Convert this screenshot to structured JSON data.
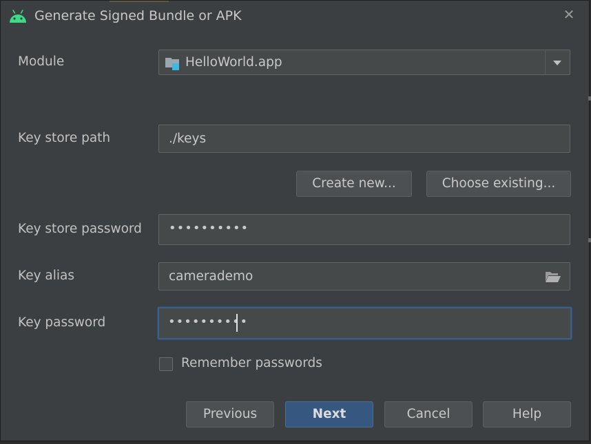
{
  "window": {
    "title": "Generate Signed Bundle or APK",
    "icon": "android-icon",
    "close_glyph": "✕"
  },
  "form": {
    "module": {
      "label": "Module",
      "value": "HelloWorld.app",
      "icon": "module-folder-icon"
    },
    "key_store_path": {
      "label": "Key store path",
      "value": "./keys"
    },
    "key_store_buttons": {
      "create_new": "Create new...",
      "choose_existing": "Choose existing..."
    },
    "key_store_password": {
      "label": "Key store password",
      "value": "••••••••••"
    },
    "key_alias": {
      "label": "Key alias",
      "value": "camerademo",
      "icon": "folder-open-icon"
    },
    "key_password": {
      "label": "Key password",
      "value": "••••••••••"
    },
    "remember_passwords": {
      "label": "Remember passwords",
      "checked": false
    }
  },
  "footer": {
    "previous": "Previous",
    "next": "Next",
    "cancel": "Cancel",
    "help": "Help"
  },
  "colors": {
    "dialog_bg": "#3c3f41",
    "field_bg": "#45494a",
    "primary_button": "#365880",
    "focus_border": "#3d6185",
    "android_green": "#3ddc84"
  }
}
